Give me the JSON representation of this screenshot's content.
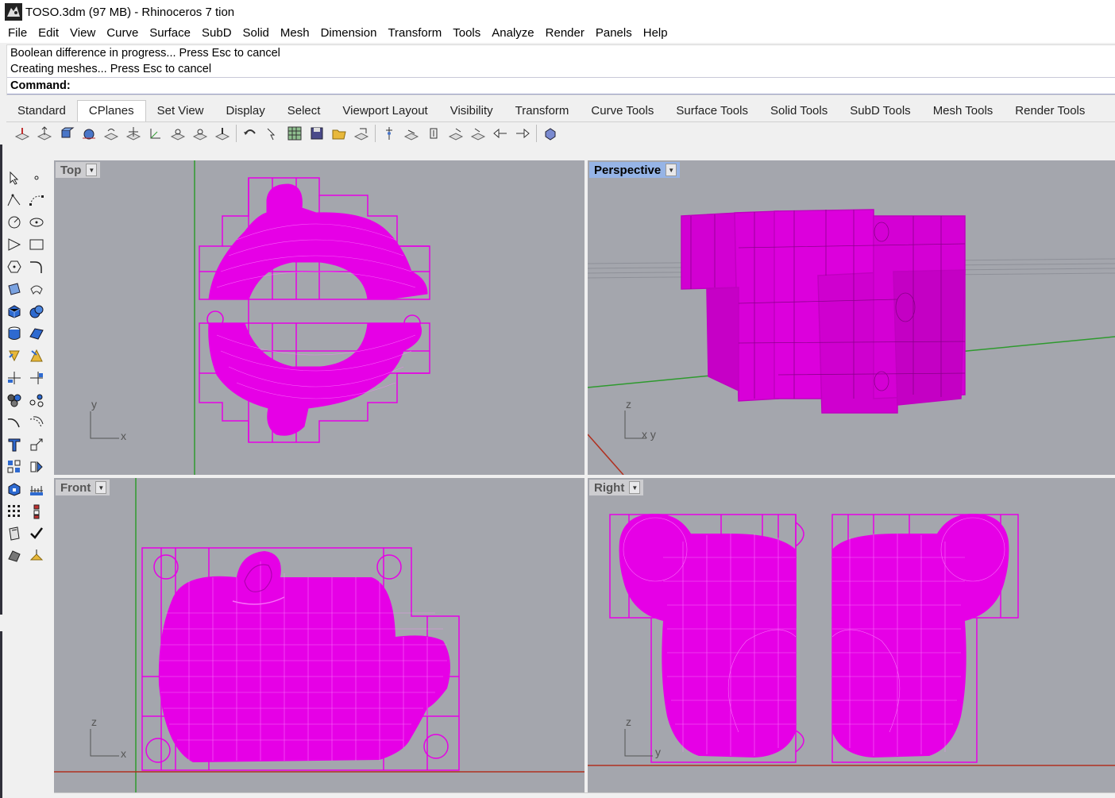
{
  "window": {
    "title": "TOSO.3dm (97 MB) - Rhinoceros 7 tion"
  },
  "menu": [
    "File",
    "Edit",
    "View",
    "Curve",
    "Surface",
    "SubD",
    "Solid",
    "Mesh",
    "Dimension",
    "Transform",
    "Tools",
    "Analyze",
    "Render",
    "Panels",
    "Help"
  ],
  "command": {
    "history": [
      "Boolean difference in progress... Press Esc to cancel",
      "Creating meshes... Press Esc to cancel"
    ],
    "prompt_label": "Command:",
    "input_value": ""
  },
  "toolbar_tabs": [
    "Standard",
    "CPlanes",
    "Set View",
    "Display",
    "Select",
    "Viewport Layout",
    "Visibility",
    "Transform",
    "Curve Tools",
    "Surface Tools",
    "Solid Tools",
    "SubD Tools",
    "Mesh Tools",
    "Render Tools"
  ],
  "active_tab": "CPlanes",
  "viewports": {
    "top": {
      "label": "Top",
      "axis_x": "x",
      "axis_y": "y"
    },
    "perspective": {
      "label": "Perspective",
      "axis_z": "z",
      "axis_xy": "x y"
    },
    "front": {
      "label": "Front",
      "axis_z": "z",
      "axis_x": "x"
    },
    "right": {
      "label": "Right",
      "axis_z": "z",
      "axis_y": "y"
    }
  },
  "colors": {
    "object": "#e600e6",
    "viewport_bg": "#a4a6ad",
    "active_viewport_label": "#96b4e6",
    "x_axis": "#b03020",
    "y_axis": "#2e9a2e"
  }
}
